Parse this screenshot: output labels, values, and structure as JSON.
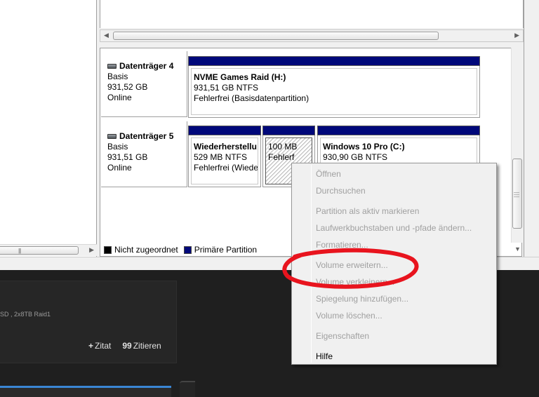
{
  "disks": [
    {
      "name": "Datenträger 4",
      "type": "Basis",
      "size": "931,52 GB",
      "status": "Online",
      "partitions": [
        {
          "name": "NVME Games Raid  (H:)",
          "size": "931,51 GB NTFS",
          "status": "Fehlerfrei (Basisdatenpartition)"
        }
      ]
    },
    {
      "name": "Datenträger 5",
      "type": "Basis",
      "size": "931,51 GB",
      "status": "Online",
      "partitions": [
        {
          "name": "Wiederherstellu",
          "size": "529 MB NTFS",
          "status": "Fehlerfrei (Wiede"
        },
        {
          "name": "",
          "size": "100 MB",
          "status": "Fehlerf"
        },
        {
          "name": "Windows 10 Pro  (C:)",
          "size": "930,90 GB NTFS",
          "status": ""
        }
      ]
    }
  ],
  "legend": [
    {
      "label": "Nicht zugeordnet",
      "color": "#000000"
    },
    {
      "label": "Primäre Partition",
      "color": "#00087a"
    }
  ],
  "context_menu": {
    "items": [
      {
        "label": "Öffnen",
        "enabled": false
      },
      {
        "label": "Durchsuchen",
        "enabled": false
      },
      {
        "label": "Partition als aktiv markieren",
        "enabled": false
      },
      {
        "label": "Laufwerkbuchstaben und -pfade ändern...",
        "enabled": false
      },
      {
        "label": "Formatieren...",
        "enabled": false
      },
      {
        "label": "Volume erweitern...",
        "enabled": false
      },
      {
        "label": "Volume verkleinern...",
        "enabled": false
      },
      {
        "label": "Spiegelung hinzufügen...",
        "enabled": false
      },
      {
        "label": "Volume löschen...",
        "enabled": false
      },
      {
        "label": "Eigenschaften",
        "enabled": false
      },
      {
        "label": "Hilfe",
        "enabled": true
      }
    ]
  },
  "background_page": {
    "subtitle": "SD , 2x8TB Raid1",
    "actions": [
      {
        "icon": "+",
        "label": "Zitat"
      },
      {
        "icon": "99",
        "label": "Zitieren"
      }
    ]
  },
  "colors": {
    "partition_cap": "#00087a",
    "annotation": "#e8141e",
    "disabled_text": "#a0a0a0"
  },
  "icons": [
    "disk-icon",
    "plus-icon",
    "quote-icon",
    "chevron-left-icon",
    "chevron-right-icon",
    "chevron-down-icon"
  ]
}
